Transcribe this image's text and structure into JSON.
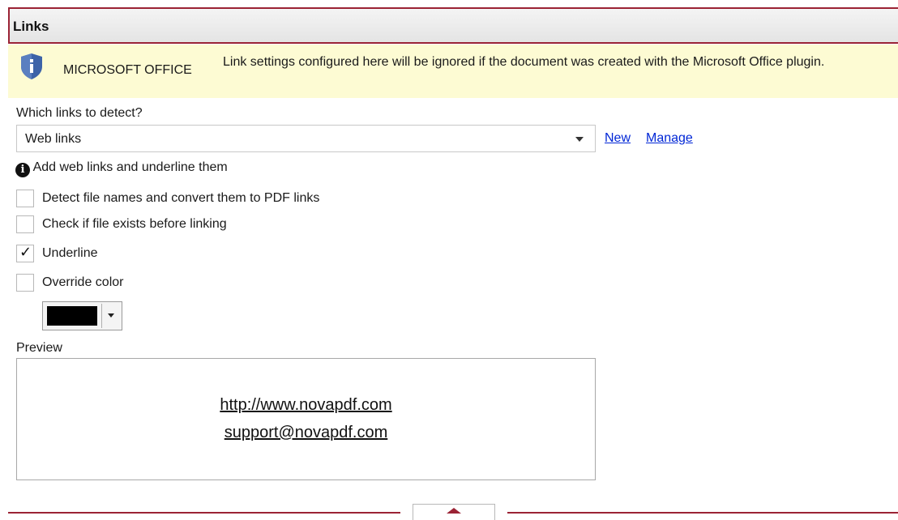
{
  "section": {
    "title": "Links"
  },
  "notice": {
    "label": "MICROSOFT OFFICE",
    "text": "Link settings configured here will be ignored if the document was created with the Microsoft Office plugin.",
    "icon": "shield-info-icon"
  },
  "detection": {
    "label": "Which links to detect?",
    "selected": "Web links",
    "new_label": "New",
    "manage_label": "Manage",
    "description": "Add web links and underline them"
  },
  "options": [
    {
      "label": "Detect file names and convert them to PDF links",
      "checked": false
    },
    {
      "label": "Check if file exists before linking",
      "checked": false
    },
    {
      "label": "Underline",
      "checked": true
    },
    {
      "label": "Override color",
      "checked": false
    }
  ],
  "color": {
    "value": "#000000"
  },
  "preview": {
    "label": "Preview",
    "lines": [
      "http://www.novapdf.com",
      "support@novapdf.com"
    ]
  },
  "colors": {
    "accent": "#9b2335",
    "link": "#0026d6",
    "notice_bg": "#fdfbd3",
    "shield": "#3d63a8"
  }
}
